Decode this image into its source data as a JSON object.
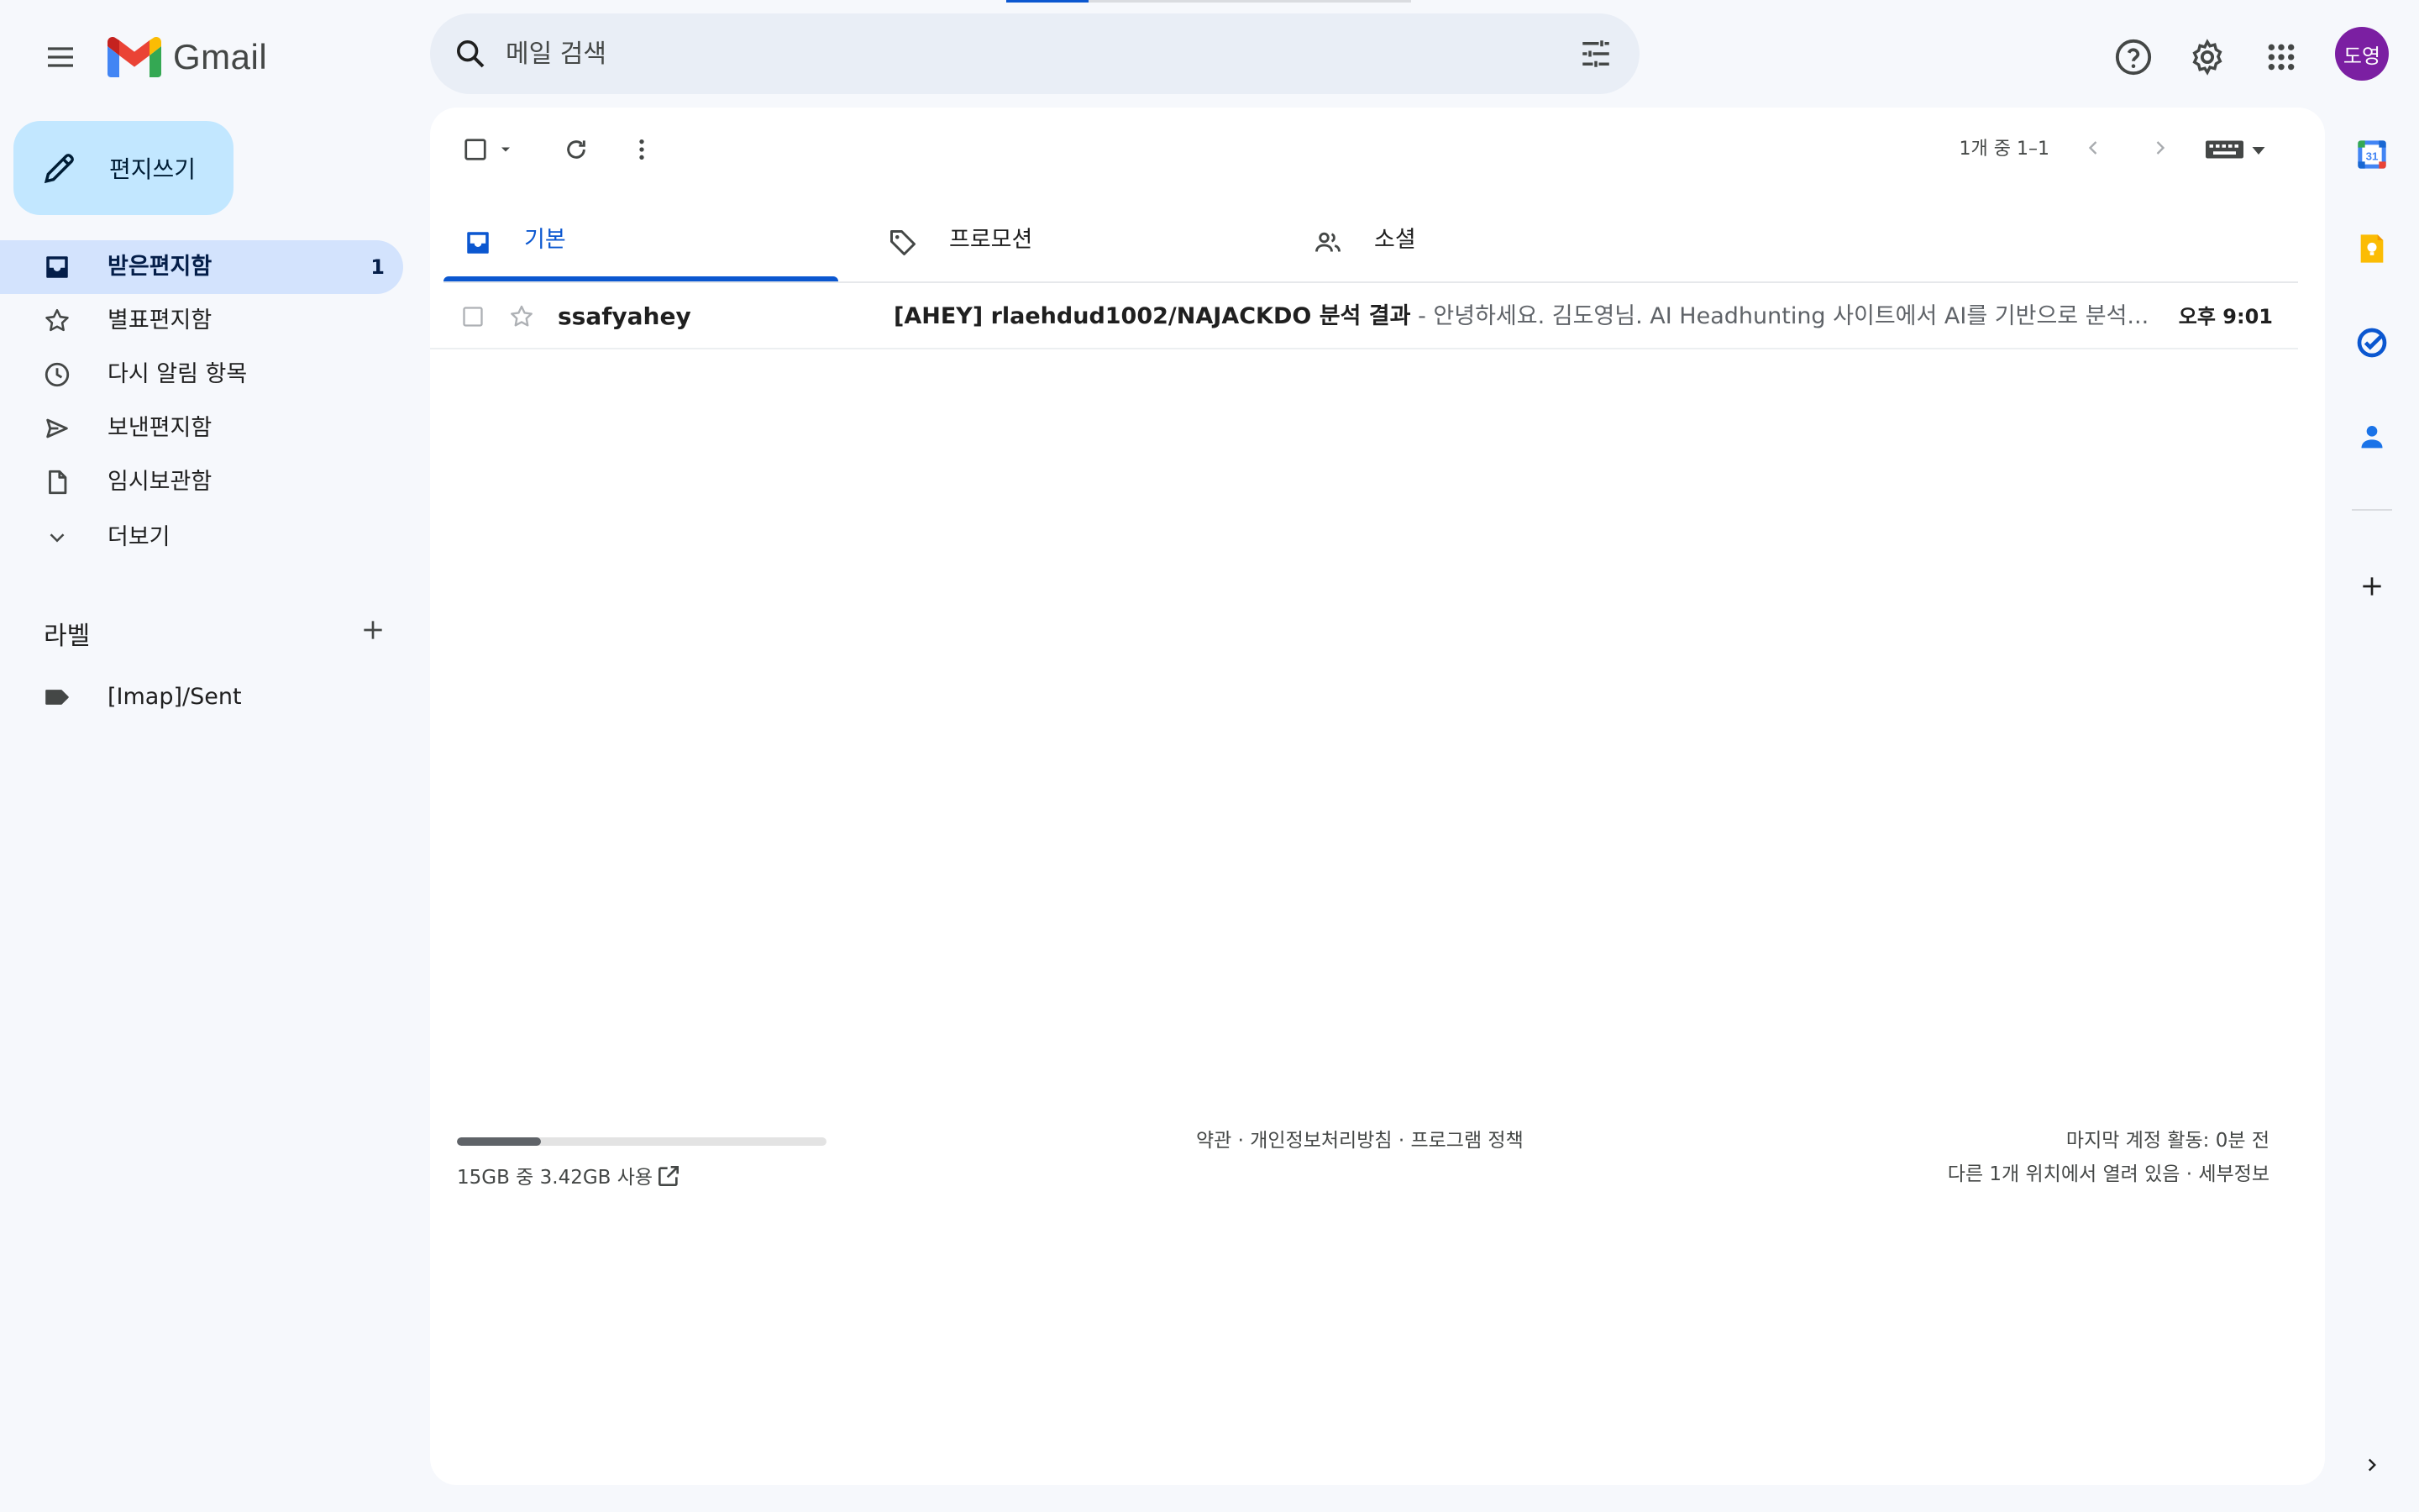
{
  "app": {
    "logo_text": "Gmail"
  },
  "search": {
    "placeholder": "메일 검색"
  },
  "user": {
    "avatar_text": "도영",
    "avatar_color": "#7b1fa2"
  },
  "compose": {
    "label": "편지쓰기"
  },
  "nav": {
    "items": [
      {
        "label": "받은편지함",
        "count": "1",
        "icon": "inbox-icon",
        "active": true
      },
      {
        "label": "별표편지함",
        "icon": "star-icon"
      },
      {
        "label": "다시 알림 항목",
        "icon": "clock-icon"
      },
      {
        "label": "보낸편지함",
        "icon": "send-icon"
      },
      {
        "label": "임시보관함",
        "icon": "draft-icon"
      },
      {
        "label": "더보기",
        "icon": "chevron-down-icon"
      }
    ]
  },
  "labels": {
    "title": "라벨",
    "items": [
      {
        "label": "[Imap]/Sent",
        "icon": "label-icon"
      }
    ]
  },
  "toolbar": {
    "pagination": "1개 중 1–1"
  },
  "tabs": [
    {
      "label": "기본",
      "icon": "inbox-icon",
      "active": true
    },
    {
      "label": "프로모션",
      "icon": "tag-icon"
    },
    {
      "label": "소셜",
      "icon": "people-icon"
    }
  ],
  "emails": [
    {
      "sender": "ssafyahey",
      "subject": "[AHEY] rlaehdud1002/NAJACKDO 분석 결과",
      "snippet": " - 안녕하세요. 김도영님. AI Headhunting 사이트에서 AI를 기반으로 분석...",
      "time": "오후 9:01",
      "unread": true
    }
  ],
  "footer": {
    "storage_text": "15GB 중 3.42GB 사용",
    "storage_used_fraction": 0.228,
    "links": "약관 · 개인정보처리방침 · 프로그램 정책",
    "activity": "마지막 계정 활동: 0분 전",
    "open_locations": "다른 1개 위치에서 열려 있음 · 세부정보"
  },
  "colors": {
    "accent": "#0b57d0",
    "compose_bg": "#c2e7ff",
    "active_nav_bg": "#d3e3fd",
    "page_bg": "#f6f8fc"
  }
}
